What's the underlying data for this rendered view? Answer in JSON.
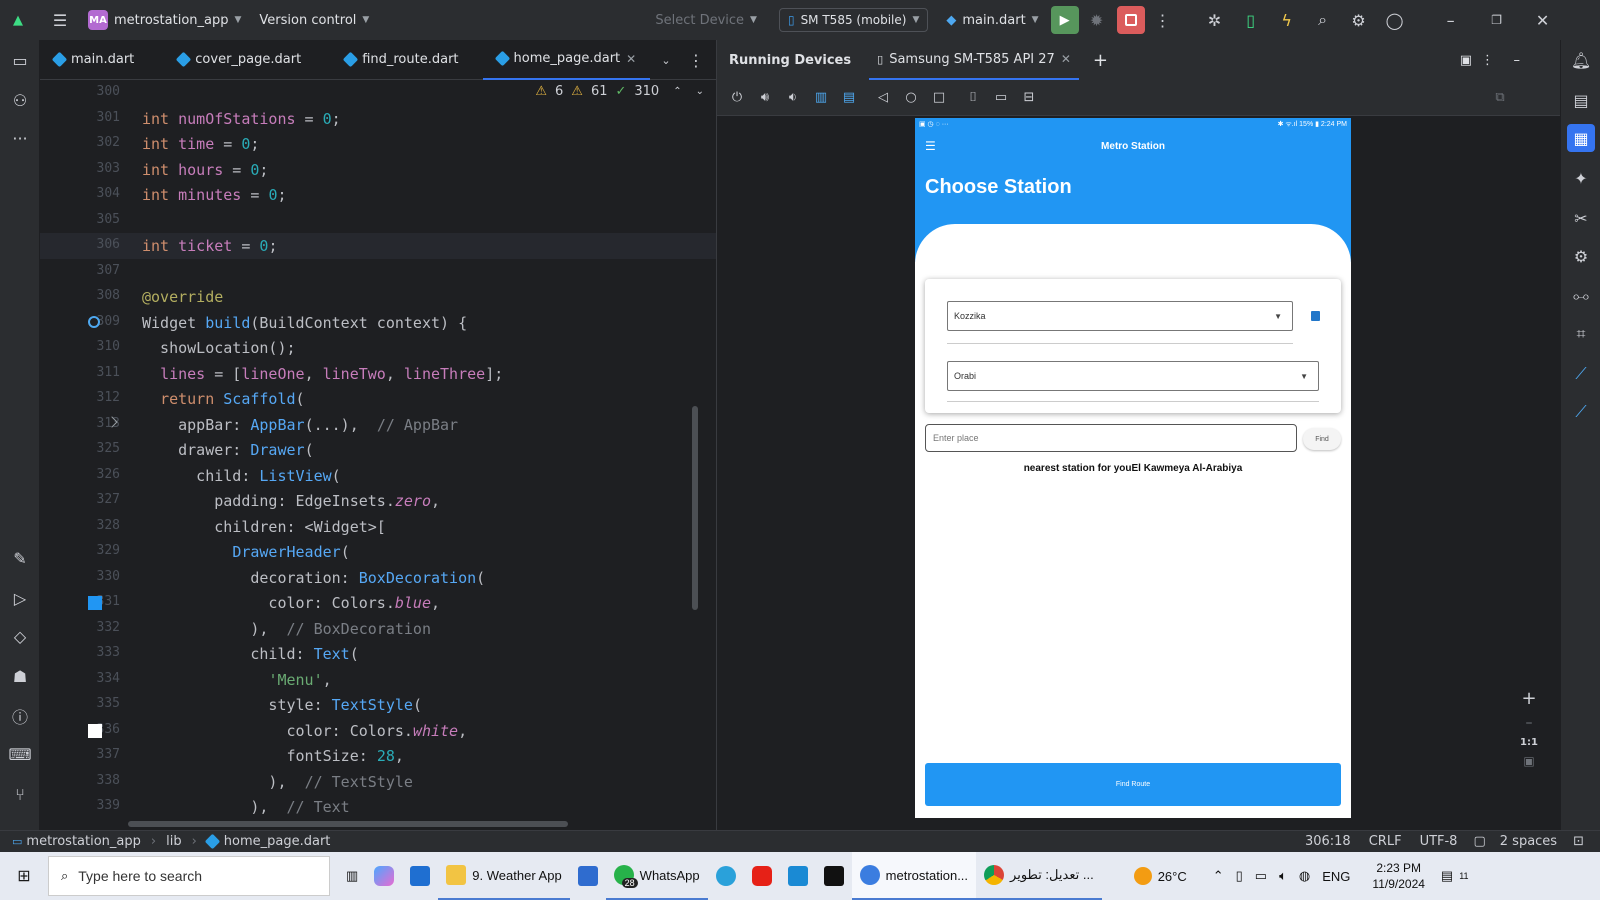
{
  "titlebar": {
    "project_badge": "MA",
    "project_name": "metrostation_app",
    "vcs": "Version control",
    "select_device": "Select Device",
    "device": "SM T585 (mobile)",
    "run_config": "main.dart"
  },
  "editor": {
    "tabs": [
      {
        "label": "main.dart"
      },
      {
        "label": "cover_page.dart"
      },
      {
        "label": "find_route.dart"
      },
      {
        "label": "home_page.dart"
      }
    ],
    "inspections": {
      "warnings": "6",
      "weak_warnings": "61",
      "ok": "310"
    },
    "lines": [
      {
        "n": "300",
        "code": ""
      },
      {
        "n": "301",
        "code": "int numOfStations = 0;"
      },
      {
        "n": "302",
        "code": "int time = 0;"
      },
      {
        "n": "303",
        "code": "int hours = 0;"
      },
      {
        "n": "304",
        "code": "int minutes = 0;"
      },
      {
        "n": "305",
        "code": ""
      },
      {
        "n": "306",
        "code": "int ticket = 0;"
      },
      {
        "n": "307",
        "code": ""
      },
      {
        "n": "308",
        "code": "@override"
      },
      {
        "n": "309",
        "code": "Widget build(BuildContext context) {"
      },
      {
        "n": "310",
        "code": "  showLocation();"
      },
      {
        "n": "311",
        "code": "  lines = [lineOne, lineTwo, lineThree];"
      },
      {
        "n": "312",
        "code": "  return Scaffold("
      },
      {
        "n": "313",
        "code": "    appBar: AppBar(...),  // AppBar"
      },
      {
        "n": "325",
        "code": "    drawer: Drawer("
      },
      {
        "n": "326",
        "code": "      child: ListView("
      },
      {
        "n": "327",
        "code": "        padding: EdgeInsets.zero,"
      },
      {
        "n": "328",
        "code": "        children: <Widget>["
      },
      {
        "n": "329",
        "code": "          DrawerHeader("
      },
      {
        "n": "330",
        "code": "            decoration: BoxDecoration("
      },
      {
        "n": "331",
        "code": "              color: Colors.blue,"
      },
      {
        "n": "332",
        "code": "            ),  // BoxDecoration"
      },
      {
        "n": "333",
        "code": "            child: Text("
      },
      {
        "n": "334",
        "code": "              'Menu',"
      },
      {
        "n": "335",
        "code": "              style: TextStyle("
      },
      {
        "n": "336",
        "code": "                color: Colors.white,"
      },
      {
        "n": "337",
        "code": "                fontSize: 28,"
      },
      {
        "n": "338",
        "code": "              ),  // TextStyle"
      },
      {
        "n": "339",
        "code": "            ),  // Text"
      }
    ]
  },
  "devices": {
    "panel_title": "Running Devices",
    "device_tab": "Samsung SM-T585 API 27",
    "zoom_label": "1:1"
  },
  "phone": {
    "status_left": "▣ ◷ ◌  ···",
    "status_right": "✱ ᯤ.ıl 15% ▮ 2:24 PM",
    "appbar_title": "Metro Station",
    "heading": "Choose Station",
    "from_station": "Kozzika",
    "to_station": "Orabi",
    "place_placeholder": "Enter place",
    "find_label": "Find",
    "nearest_text": "nearest station for youEl Kawmeya Al-Arabiya",
    "route_button": "Find Route"
  },
  "statusbar": {
    "breadcrumb": [
      "metrostation_app",
      "lib",
      "home_page.dart"
    ],
    "position": "306:18",
    "line_sep": "CRLF",
    "encoding": "UTF-8",
    "indent": "2 spaces"
  },
  "taskbar": {
    "search_placeholder": "Type here to search",
    "apps": [
      {
        "label": "9. Weather App"
      },
      {
        "label": "WhatsApp",
        "badge": "28"
      },
      {
        "label": "metrostation..."
      },
      {
        "label": "تعديل: تطوير ..."
      }
    ],
    "temperature": "26°C",
    "language": "ENG",
    "time": "2:23 PM",
    "date": "11/9/2024",
    "notification_count": "11"
  },
  "colors": {
    "accent": "#3574f0",
    "flutter_blue": "#2196f3",
    "run_green": "#57965c",
    "stop_red": "#db5c5c"
  }
}
